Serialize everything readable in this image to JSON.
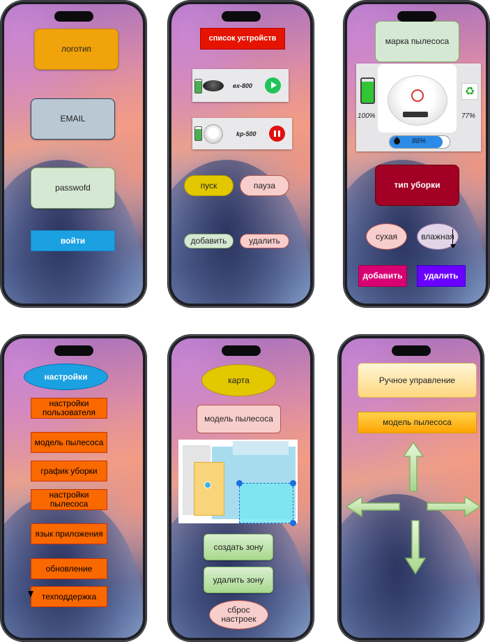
{
  "screen1": {
    "logo": "логотип",
    "email": "EMAIL",
    "password": "passwofd",
    "login": "войти"
  },
  "screen2": {
    "title": "список устройств",
    "devices": [
      {
        "name": "ex-800",
        "action": "play"
      },
      {
        "name": "kp-500",
        "action": "pause"
      }
    ],
    "start": "пуск",
    "pause": "пауза",
    "add": "добавить",
    "delete": "удалить"
  },
  "screen3": {
    "brand": "марка пылесоса",
    "battery": "100%",
    "bin": "77%",
    "water": "88%",
    "cleaning_type": "тип уборки",
    "dry": "сухая",
    "wet": "влажная",
    "add": "добавить",
    "delete": "удалить"
  },
  "screen4": {
    "title": "настройки",
    "items": [
      "настройки пользователя",
      "модель пылесоса",
      "график уборки",
      "настройки пылесоса",
      "язык приложения",
      "обновление",
      "техподдержка"
    ]
  },
  "screen5": {
    "map": "карта",
    "model": "модель пылесоса",
    "create_zone": "создать зону",
    "delete_zone": "удалить зону",
    "reset": "сброс настроек"
  },
  "screen6": {
    "manual": "Ручное управление",
    "model": "модель пылесоса",
    "arrows": [
      "up-arrow-icon",
      "left-arrow-icon",
      "right-arrow-icon",
      "down-arrow-icon"
    ]
  },
  "colors": {
    "orange": "#ff6d00",
    "red": "#e01010",
    "blue": "#1a9be0",
    "green_light": "#d5e8d4",
    "pink_light": "#f8cecc",
    "yellow": "#e3c800"
  }
}
